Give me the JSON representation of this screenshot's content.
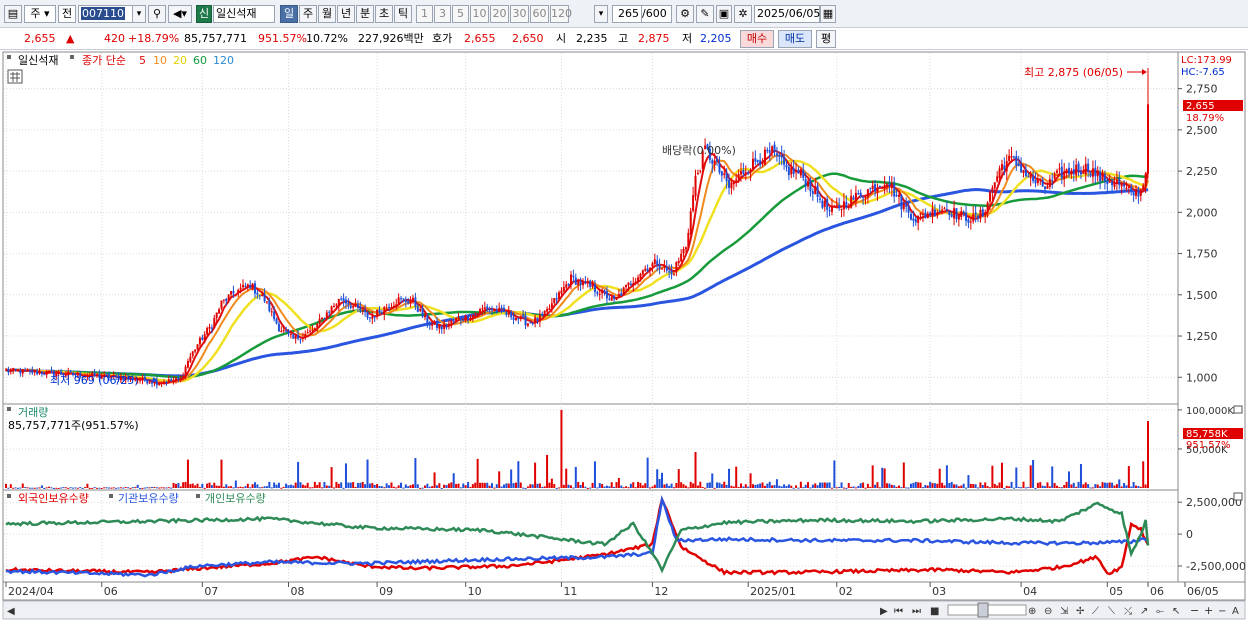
{
  "toolbar": {
    "market": "주",
    "prev_label": "전",
    "code": "007110",
    "stock_badge": "신",
    "stock_name": "일신석재",
    "periods": [
      "일",
      "주",
      "월",
      "년",
      "분",
      "초",
      "틱"
    ],
    "intervals": [
      "1",
      "3",
      "5",
      "10",
      "20",
      "30",
      "60",
      "120"
    ],
    "count": "265",
    "count_total": "/600",
    "date": "2025/06/05"
  },
  "quote": {
    "price": "2,655",
    "arrow": "▲",
    "change": "420",
    "change_pct": "+18.79%",
    "volume": "85,757,771",
    "volume_ratio": "951.57%",
    "turnover": "10.72%",
    "amount": "227,926백만",
    "quote_label": "호가",
    "ask": "2,655",
    "bid": "2,650",
    "open_label": "시",
    "open": "2,235",
    "high_label": "고",
    "high": "2,875",
    "low_label": "저",
    "low": "2,205",
    "buy_label": "매수",
    "sell_label": "매도",
    "eval_label": "평"
  },
  "price_panel": {
    "name_legend": "일신석재",
    "ma_legend": "종가 단순",
    "ma_periods": [
      "5",
      "10",
      "20",
      "60",
      "120"
    ],
    "lc": "LC:173.99",
    "hc": "HC:-7.65",
    "high_note": "최고 2,875 (06/05)",
    "low_note": "최저 969 (06/25)",
    "annotation": "배당락(0.00%)",
    "last_price_tag": "2,655",
    "last_pct_tag": "18.79%"
  },
  "volume_panel": {
    "title": "거래량",
    "value": "85,757,771주(951.57%)",
    "last_tag": "85,758K",
    "last_pct": "951.57%"
  },
  "holding_panel": {
    "legend": [
      "외국인보유수량",
      "기관보유수량",
      "개인보유수량"
    ]
  },
  "colors": {
    "up": "#e00000",
    "down": "#1d4fd8",
    "ma5": "#e01010",
    "ma10": "#f08a1c",
    "ma20": "#f0e020",
    "ma60": "#169a3a",
    "ma120": "#2a55e0",
    "foreign": "#e00000",
    "institution": "#2a55e0",
    "individual": "#2e8b57"
  },
  "chart_data": [
    {
      "type": "candlestick",
      "title": "일신석재",
      "x_ticks": [
        "2024/04",
        "06",
        "07",
        "08",
        "09",
        "10",
        "11",
        "12",
        "2025/01",
        "02",
        "03",
        "04",
        "05",
        "06",
        "06/05"
      ],
      "y_ticks": [
        1000,
        1250,
        1500,
        1750,
        2000,
        2250,
        2500,
        2750
      ],
      "y_tick_labels": [
        "1,000",
        "1,250",
        "1,500",
        "1,750",
        "2,000",
        "2,250",
        "2,500",
        "2,750"
      ],
      "ylim": [
        850,
        2960
      ],
      "close_anchors": [
        [
          0,
          1040
        ],
        [
          20,
          1025
        ],
        [
          40,
          1005
        ],
        [
          55,
          990
        ],
        [
          63,
          969
        ],
        [
          73,
          985
        ],
        [
          76,
          1100
        ],
        [
          80,
          1200
        ],
        [
          86,
          1320
        ],
        [
          90,
          1450
        ],
        [
          96,
          1520
        ],
        [
          102,
          1560
        ],
        [
          108,
          1470
        ],
        [
          114,
          1300
        ],
        [
          120,
          1230
        ],
        [
          128,
          1280
        ],
        [
          134,
          1390
        ],
        [
          140,
          1480
        ],
        [
          146,
          1420
        ],
        [
          152,
          1360
        ],
        [
          158,
          1420
        ],
        [
          164,
          1470
        ],
        [
          170,
          1460
        ],
        [
          176,
          1330
        ],
        [
          182,
          1300
        ],
        [
          188,
          1350
        ],
        [
          194,
          1370
        ],
        [
          200,
          1420
        ],
        [
          206,
          1400
        ],
        [
          212,
          1370
        ],
        [
          218,
          1330
        ],
        [
          224,
          1360
        ],
        [
          230,
          1480
        ],
        [
          236,
          1600
        ],
        [
          242,
          1560
        ],
        [
          248,
          1520
        ],
        [
          254,
          1460
        ],
        [
          260,
          1560
        ],
        [
          266,
          1650
        ],
        [
          272,
          1700
        ],
        [
          278,
          1620
        ],
        [
          284,
          1800
        ],
        [
          288,
          2200
        ],
        [
          292,
          2380
        ],
        [
          296,
          2300
        ],
        [
          302,
          2150
        ],
        [
          308,
          2250
        ],
        [
          314,
          2320
        ],
        [
          320,
          2360
        ],
        [
          326,
          2260
        ],
        [
          332,
          2230
        ],
        [
          338,
          2120
        ],
        [
          344,
          2000
        ],
        [
          350,
          2050
        ],
        [
          356,
          2100
        ],
        [
          362,
          2150
        ],
        [
          368,
          2200
        ],
        [
          374,
          2050
        ],
        [
          380,
          1960
        ],
        [
          386,
          2000
        ],
        [
          392,
          2030
        ],
        [
          398,
          1980
        ],
        [
          404,
          1960
        ],
        [
          408,
          1990
        ],
        [
          412,
          2150
        ],
        [
          416,
          2290
        ],
        [
          420,
          2320
        ],
        [
          424,
          2270
        ],
        [
          428,
          2200
        ],
        [
          434,
          2150
        ],
        [
          440,
          2230
        ],
        [
          446,
          2260
        ],
        [
          452,
          2270
        ],
        [
          458,
          2200
        ],
        [
          464,
          2180
        ],
        [
          470,
          2110
        ],
        [
          474,
          2130
        ],
        [
          476,
          2235
        ],
        [
          477,
          2655
        ]
      ],
      "last": {
        "open": 2235,
        "high": 2875,
        "low": 2205,
        "close": 2655
      }
    },
    {
      "type": "bar",
      "title": "거래량",
      "y_ticks": [
        50000,
        100000
      ],
      "y_tick_labels": [
        "50,000K",
        "100,000K"
      ],
      "ylim": [
        0,
        105000
      ],
      "last_value": 85757771
    },
    {
      "type": "line",
      "y_ticks": [
        2500000,
        0,
        -2500000
      ],
      "y_tick_labels": [
        "2,500,000",
        "0",
        "-2,500,000"
      ],
      "ylim": [
        -3600000,
        3300000
      ],
      "series": [
        {
          "name": "외국인보유수량",
          "anchors": [
            [
              0,
              -2800000
            ],
            [
              60,
              -3000000
            ],
            [
              80,
              -2700000
            ],
            [
              110,
              -2300000
            ],
            [
              130,
              -1800000
            ],
            [
              150,
              -2500000
            ],
            [
              170,
              -2700000
            ],
            [
              190,
              -2600000
            ],
            [
              210,
              -2500000
            ],
            [
              230,
              -2100000
            ],
            [
              250,
              -1600000
            ],
            [
              270,
              -800000
            ],
            [
              274,
              2800000
            ],
            [
              282,
              -1000000
            ],
            [
              300,
              -3000000
            ],
            [
              330,
              -3000000
            ],
            [
              360,
              -2900000
            ],
            [
              390,
              -2800000
            ],
            [
              420,
              -3000000
            ],
            [
              440,
              -2600000
            ],
            [
              456,
              -1800000
            ],
            [
              460,
              -3100000
            ],
            [
              466,
              -2600000
            ],
            [
              470,
              800000
            ],
            [
              474,
              400000
            ],
            [
              476,
              -500000
            ],
            [
              477,
              -800000
            ]
          ]
        },
        {
          "name": "기관보유수량",
          "anchors": [
            [
              0,
              -2900000
            ],
            [
              60,
              -3200000
            ],
            [
              80,
              -2500000
            ],
            [
              110,
              -2200000
            ],
            [
              150,
              -2300000
            ],
            [
              200,
              -2000000
            ],
            [
              250,
              -1800000
            ],
            [
              270,
              -1500000
            ],
            [
              274,
              2700000
            ],
            [
              280,
              -500000
            ],
            [
              300,
              -400000
            ],
            [
              340,
              -500000
            ],
            [
              380,
              -500000
            ],
            [
              420,
              -700000
            ],
            [
              450,
              -700000
            ],
            [
              470,
              -600000
            ],
            [
              477,
              -300000
            ]
          ]
        },
        {
          "name": "개인보유수량",
          "anchors": [
            [
              0,
              800000
            ],
            [
              60,
              1000000
            ],
            [
              110,
              1200000
            ],
            [
              150,
              500000
            ],
            [
              200,
              300000
            ],
            [
              250,
              -800000
            ],
            [
              262,
              800000
            ],
            [
              270,
              -1500000
            ],
            [
              274,
              -2800000
            ],
            [
              282,
              300000
            ],
            [
              300,
              900000
            ],
            [
              340,
              1100000
            ],
            [
              380,
              1000000
            ],
            [
              420,
              1200000
            ],
            [
              440,
              1000000
            ],
            [
              456,
              2400000
            ],
            [
              466,
              1600000
            ],
            [
              470,
              -1600000
            ],
            [
              474,
              0
            ],
            [
              476,
              1000000
            ],
            [
              477,
              -800000
            ]
          ]
        }
      ]
    }
  ]
}
